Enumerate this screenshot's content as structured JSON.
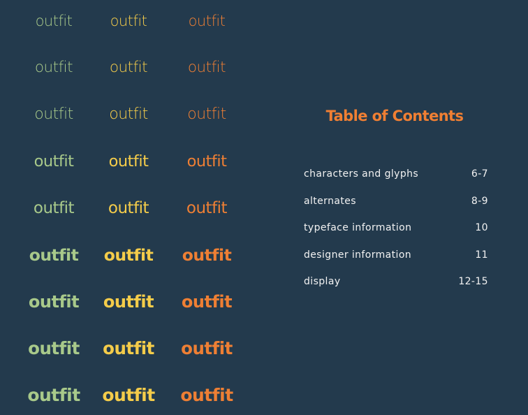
{
  "specimen": {
    "word": "outfit",
    "colors": {
      "green": "#a8c98a",
      "yellow": "#f4cc4a",
      "orange": "#ee7f34"
    },
    "weights": [
      100,
      200,
      300,
      400,
      500,
      600,
      700,
      800,
      900
    ]
  },
  "toc": {
    "title": "Table of Contents",
    "items": [
      {
        "label": "characters and glyphs",
        "pages": "6-7"
      },
      {
        "label": "alternates",
        "pages": "8-9"
      },
      {
        "label": "typeface information",
        "pages": "10"
      },
      {
        "label": "designer information",
        "pages": "11"
      },
      {
        "label": "display",
        "pages": "12-15"
      }
    ]
  },
  "colors": {
    "background": "#233a4d",
    "title_accent": "#f07f33",
    "body_text": "#f2f2f2"
  }
}
